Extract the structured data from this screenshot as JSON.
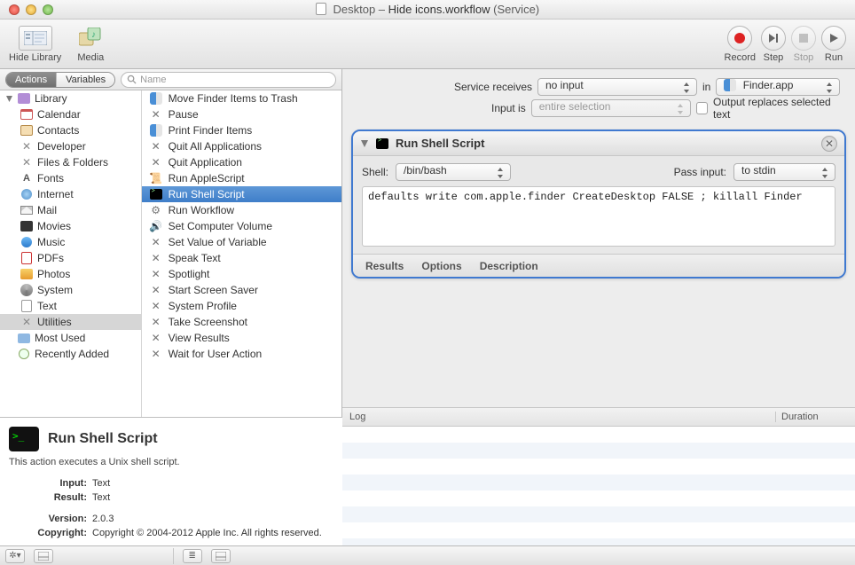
{
  "window": {
    "title_prefix": "Desktop – ",
    "title_main": "Hide icons.workflow",
    "title_suffix": " (Service)"
  },
  "toolbar": {
    "hide_library": "Hide Library",
    "media": "Media",
    "record": "Record",
    "step": "Step",
    "stop": "Stop",
    "run": "Run"
  },
  "tabs": {
    "actions": "Actions",
    "variables": "Variables"
  },
  "search": {
    "placeholder": "Name"
  },
  "library": {
    "root": "Library",
    "items": [
      "Calendar",
      "Contacts",
      "Developer",
      "Files & Folders",
      "Fonts",
      "Internet",
      "Mail",
      "Movies",
      "Music",
      "PDFs",
      "Photos",
      "System",
      "Text",
      "Utilities"
    ],
    "selected": "Utilities",
    "extras": [
      "Most Used",
      "Recently Added"
    ]
  },
  "actions_list": [
    "Move Finder Items to Trash",
    "Pause",
    "Print Finder Items",
    "Quit All Applications",
    "Quit Application",
    "Run AppleScript",
    "Run Shell Script",
    "Run Workflow",
    "Set Computer Volume",
    "Set Value of Variable",
    "Speak Text",
    "Spotlight",
    "Start Screen Saver",
    "System Profile",
    "Take Screenshot",
    "View Results",
    "Wait for User Action"
  ],
  "actions_selected": "Run Shell Script",
  "info": {
    "title": "Run Shell Script",
    "desc": "This action executes a Unix shell script.",
    "input_k": "Input:",
    "input_v": "Text",
    "result_k": "Result:",
    "result_v": "Text",
    "version_k": "Version:",
    "version_v": "2.0.3",
    "copyright_k": "Copyright:",
    "copyright_v": "Copyright © 2004-2012 Apple Inc.  All rights reserved."
  },
  "service": {
    "receives_label": "Service receives",
    "receives_value": "no input",
    "in_word": "in",
    "app_value": "Finder.app",
    "inputis_label": "Input is",
    "inputis_value": "entire selection",
    "replace_label": "Output replaces selected text"
  },
  "card": {
    "title": "Run Shell Script",
    "shell_label": "Shell:",
    "shell_value": "/bin/bash",
    "pass_label": "Pass input:",
    "pass_value": "to stdin",
    "code": "defaults write com.apple.finder CreateDesktop FALSE ; killall Finder",
    "foot_results": "Results",
    "foot_options": "Options",
    "foot_desc": "Description"
  },
  "log": {
    "col1": "Log",
    "col2": "Duration"
  }
}
